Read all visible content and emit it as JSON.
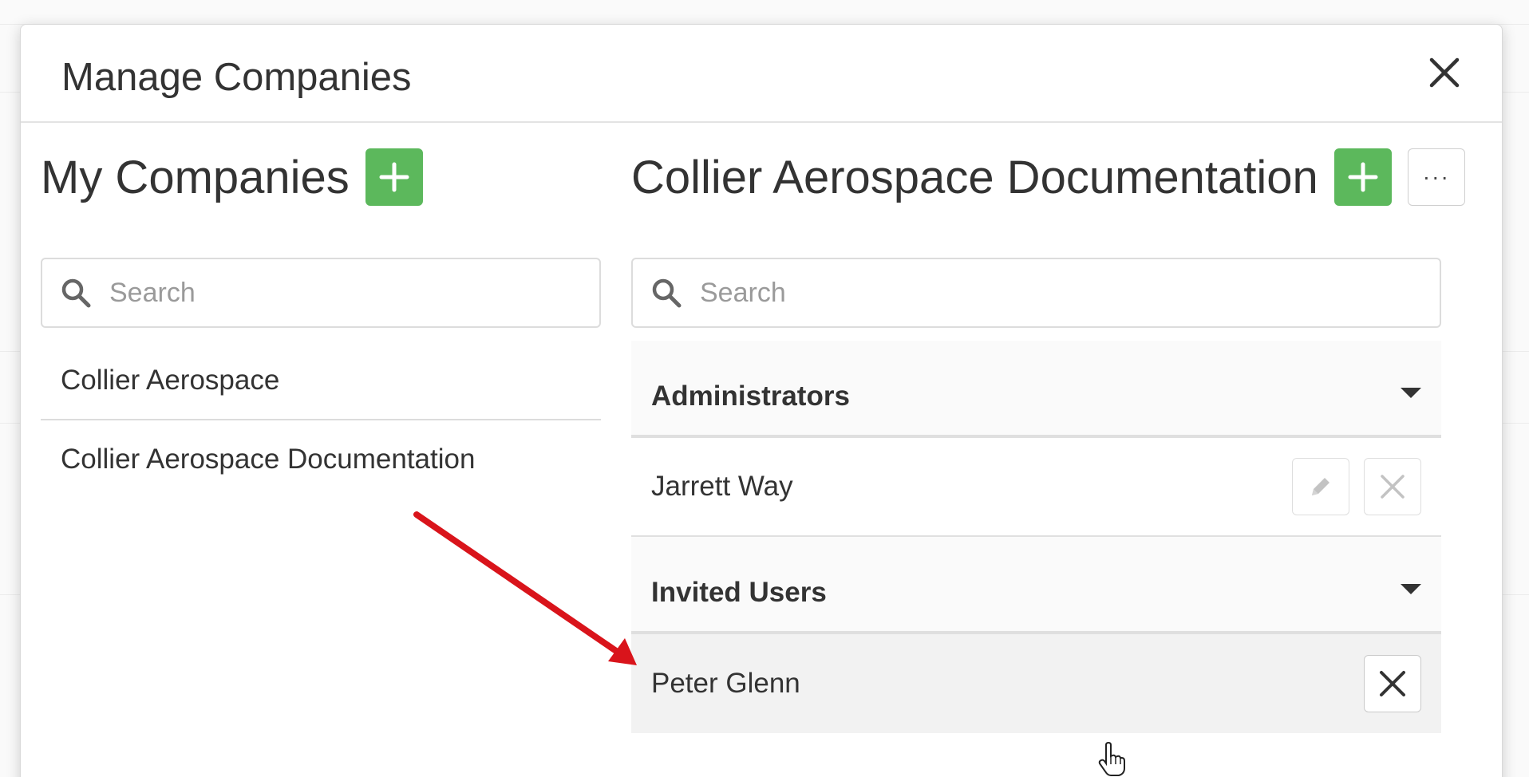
{
  "modal": {
    "title": "Manage Companies"
  },
  "my_companies": {
    "title": "My Companies",
    "search_placeholder": "Search",
    "companies": [
      {
        "name": "Collier Aerospace"
      },
      {
        "name": "Collier Aerospace Documentation"
      }
    ]
  },
  "selected_company": {
    "title": "Collier Aerospace Documentation",
    "more_label": "···",
    "search_placeholder": "Search",
    "sections": [
      {
        "title": "Administrators",
        "users": [
          {
            "name": "Jarrett Way",
            "actions": [
              "edit",
              "remove"
            ]
          }
        ]
      },
      {
        "title": "Invited Users",
        "users": [
          {
            "name": "Peter Glenn",
            "actions": [
              "remove"
            ]
          }
        ]
      }
    ]
  },
  "colors": {
    "add_button": "#5cb85c",
    "annotation_arrow": "#d9141b"
  },
  "icons": [
    "close-icon",
    "plus-icon",
    "search-icon",
    "pencil-icon",
    "x-icon",
    "caret-down-icon",
    "hand-cursor-icon"
  ]
}
